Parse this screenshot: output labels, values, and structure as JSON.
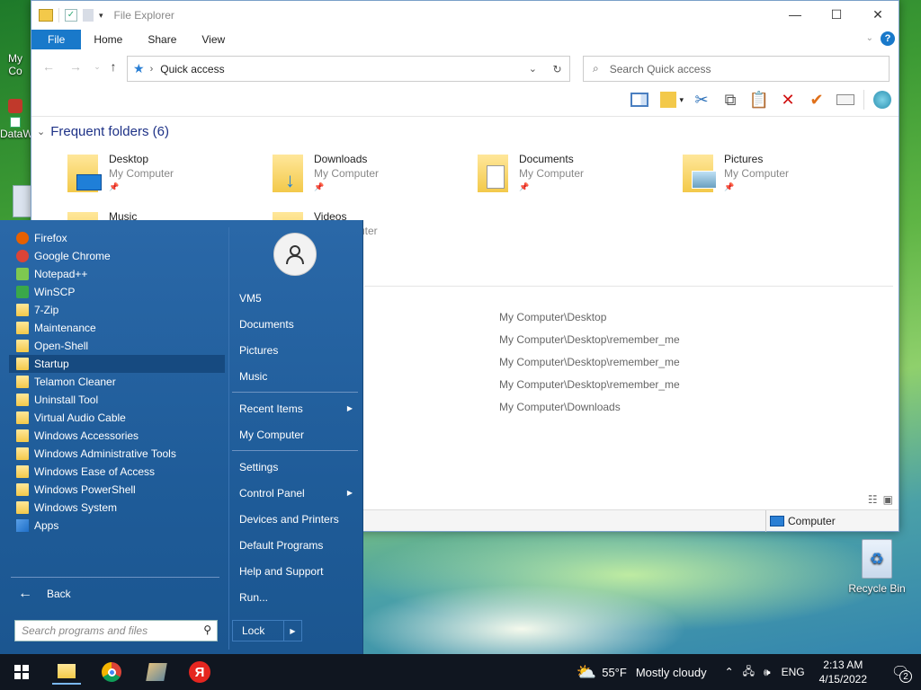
{
  "desktop": {
    "icons": [
      {
        "label": "My Co"
      },
      {
        "label": "DataW"
      },
      {
        "label": "Recycle Bin"
      }
    ]
  },
  "explorer": {
    "title": "File Explorer",
    "ribbon_tabs": [
      "File",
      "Home",
      "Share",
      "View"
    ],
    "address": "Quick access",
    "search_placeholder": "Search Quick access",
    "section_title": "Frequent folders (6)",
    "folders": [
      {
        "name": "Desktop",
        "location": "My Computer"
      },
      {
        "name": "Downloads",
        "location": "My Computer"
      },
      {
        "name": "Documents",
        "location": "My Computer"
      },
      {
        "name": "Pictures",
        "location": "My Computer"
      },
      {
        "name": "Music",
        "location": ""
      },
      {
        "name": "Videos",
        "location": "uter"
      }
    ],
    "recent_paths": [
      "My Computer\\Desktop",
      "My Computer\\Desktop\\remember_me",
      "My Computer\\Desktop\\remember_me",
      "My Computer\\Desktop\\remember_me",
      "My Computer\\Downloads"
    ],
    "status_location": "Computer"
  },
  "start_menu": {
    "programs": [
      {
        "label": "Firefox",
        "icon": "firefox-icon",
        "color": "#e66000"
      },
      {
        "label": "Google Chrome",
        "icon": "chrome-icon",
        "color": "#db4437"
      },
      {
        "label": "Notepad++",
        "icon": "notepadpp-icon",
        "color": "#7ec850"
      },
      {
        "label": "WinSCP",
        "icon": "winscp-icon",
        "color": "#3aa84a"
      },
      {
        "label": "7-Zip",
        "icon": "folder-icon"
      },
      {
        "label": "Maintenance",
        "icon": "folder-icon"
      },
      {
        "label": "Open-Shell",
        "icon": "folder-icon"
      },
      {
        "label": "Startup",
        "icon": "folder-icon",
        "selected": true
      },
      {
        "label": "Telamon Cleaner",
        "icon": "folder-icon"
      },
      {
        "label": "Uninstall Tool",
        "icon": "folder-icon"
      },
      {
        "label": "Virtual Audio Cable",
        "icon": "folder-icon"
      },
      {
        "label": "Windows Accessories",
        "icon": "folder-icon"
      },
      {
        "label": "Windows Administrative Tools",
        "icon": "folder-icon"
      },
      {
        "label": "Windows Ease of Access",
        "icon": "folder-icon"
      },
      {
        "label": "Windows PowerShell",
        "icon": "folder-icon"
      },
      {
        "label": "Windows System",
        "icon": "folder-icon"
      },
      {
        "label": "Apps",
        "icon": "apps-icon"
      }
    ],
    "back_label": "Back",
    "search_placeholder": "Search programs and files",
    "right_items": [
      {
        "label": "VM5"
      },
      {
        "label": "Documents"
      },
      {
        "label": "Pictures"
      },
      {
        "label": "Music"
      },
      {
        "sep": true
      },
      {
        "label": "Recent Items",
        "submenu": true
      },
      {
        "label": "My Computer"
      },
      {
        "sep": true
      },
      {
        "label": "Settings"
      },
      {
        "label": "Control Panel",
        "submenu": true
      },
      {
        "label": "Devices and Printers"
      },
      {
        "label": "Default Programs"
      },
      {
        "label": "Help and Support"
      },
      {
        "label": "Run..."
      }
    ],
    "lock_label": "Lock"
  },
  "taskbar": {
    "weather_temp": "55°F",
    "weather_desc": "Mostly cloudy",
    "language": "ENG",
    "time": "2:13 AM",
    "date": "4/15/2022",
    "notification_count": "2"
  }
}
